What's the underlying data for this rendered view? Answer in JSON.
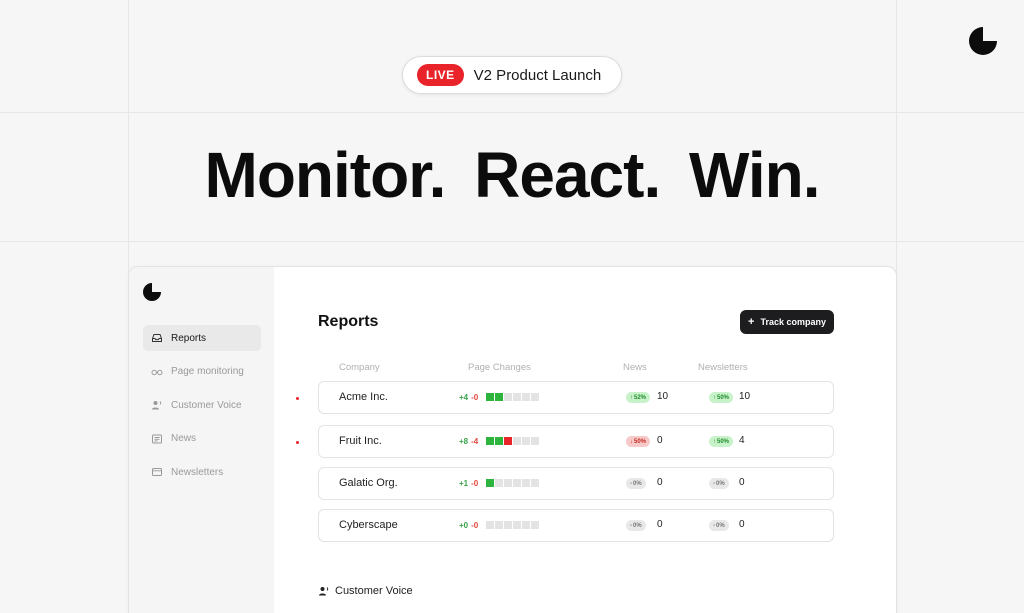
{
  "hero": {
    "live_label": "LIVE",
    "announcement": "V2 Product Launch",
    "headline": "Monitor. React. Win."
  },
  "sidebar": {
    "items": [
      {
        "label": "Reports",
        "icon": "inbox-icon",
        "active": true
      },
      {
        "label": "Page monitoring",
        "icon": "glasses-icon",
        "active": false
      },
      {
        "label": "Customer Voice",
        "icon": "person-voice-icon",
        "active": false
      },
      {
        "label": "News",
        "icon": "newspaper-icon",
        "active": false
      },
      {
        "label": "Newsletters",
        "icon": "mail-window-icon",
        "active": false
      }
    ]
  },
  "main": {
    "title": "Reports",
    "track_button": "Track company",
    "columns": {
      "company": "Company",
      "page_changes": "Page Changes",
      "news": "News",
      "newsletters": "Newsletters"
    },
    "rows": [
      {
        "company": "Acme Inc.",
        "unread": true,
        "plus": "+4",
        "minus": "-0",
        "squares": [
          "g",
          "g",
          "n",
          "n",
          "n",
          "n"
        ],
        "news_badge": "52%",
        "news_trend": "up",
        "news_count": "10",
        "newsletters_badge": "50%",
        "newsletters_trend": "up",
        "newsletters_count": "10"
      },
      {
        "company": "Fruit Inc.",
        "unread": true,
        "plus": "+8",
        "minus": "-4",
        "squares": [
          "g",
          "g",
          "r",
          "n",
          "n",
          "n"
        ],
        "news_badge": "50%",
        "news_trend": "down",
        "news_count": "0",
        "newsletters_badge": "50%",
        "newsletters_trend": "up",
        "newsletters_count": "4"
      },
      {
        "company": "Galatic Org.",
        "unread": false,
        "plus": "+1",
        "minus": "-0",
        "squares": [
          "g",
          "n",
          "n",
          "n",
          "n",
          "n"
        ],
        "news_badge": "0%",
        "news_trend": "flat",
        "news_count": "0",
        "newsletters_badge": "0%",
        "newsletters_trend": "flat",
        "newsletters_count": "0"
      },
      {
        "company": "Cyberscape",
        "unread": false,
        "plus": "+0",
        "minus": "-0",
        "squares": [
          "n",
          "n",
          "n",
          "n",
          "n",
          "n"
        ],
        "news_badge": "0%",
        "news_trend": "flat",
        "news_count": "0",
        "newsletters_badge": "0%",
        "newsletters_trend": "flat",
        "newsletters_count": "0"
      }
    ],
    "section_label": "Customer Voice"
  },
  "colors": {
    "accent_red": "#e8242a",
    "positive_green": "#2db43c",
    "button_dark": "#1d1d1f"
  }
}
